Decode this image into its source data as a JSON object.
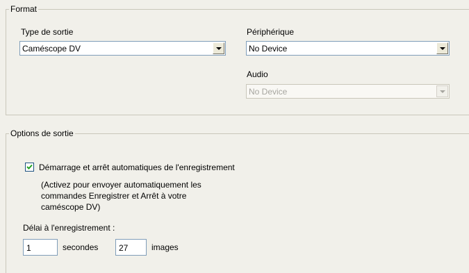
{
  "format": {
    "title": "Format",
    "output_type_label": "Type de sortie",
    "output_type_value": "Caméscope DV",
    "device_label": "Périphérique",
    "device_value": "No Device",
    "audio_label": "Audio",
    "audio_value": "No Device"
  },
  "options": {
    "title": "Options de sortie",
    "auto_record_checked": true,
    "auto_record_label": "Démarrage et arrêt automatiques de l'enregistrement",
    "help_line1": "(Activez pour envoyer automatiquement les",
    "help_line2": "commandes Enregistrer et Arrêt à votre",
    "help_line3": "caméscope DV)",
    "delay_label": "Délai à l'enregistrement :",
    "seconds_value": "1",
    "seconds_label": "secondes",
    "frames_value": "27",
    "frames_label": "images"
  }
}
